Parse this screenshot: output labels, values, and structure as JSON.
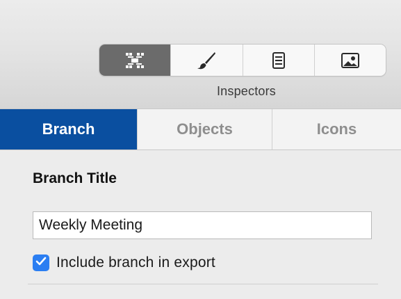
{
  "toolbar": {
    "segments": [
      {
        "icon": "branch-layout-icon",
        "active": true
      },
      {
        "icon": "brush-icon",
        "active": false
      },
      {
        "icon": "document-icon",
        "active": false
      },
      {
        "icon": "image-icon",
        "active": false
      }
    ],
    "label": "Inspectors"
  },
  "tabs": [
    {
      "label": "Branch",
      "active": true
    },
    {
      "label": "Objects",
      "active": false
    },
    {
      "label": "Icons",
      "active": false
    }
  ],
  "branch": {
    "section_title": "Branch Title",
    "title_value": "Weekly Meeting",
    "include_in_export_label": "Include branch in export",
    "include_in_export_checked": true
  },
  "colors": {
    "active_tab": "#0a4fa0",
    "checkbox": "#2b7ef2",
    "active_segment": "#6b6b6b"
  }
}
